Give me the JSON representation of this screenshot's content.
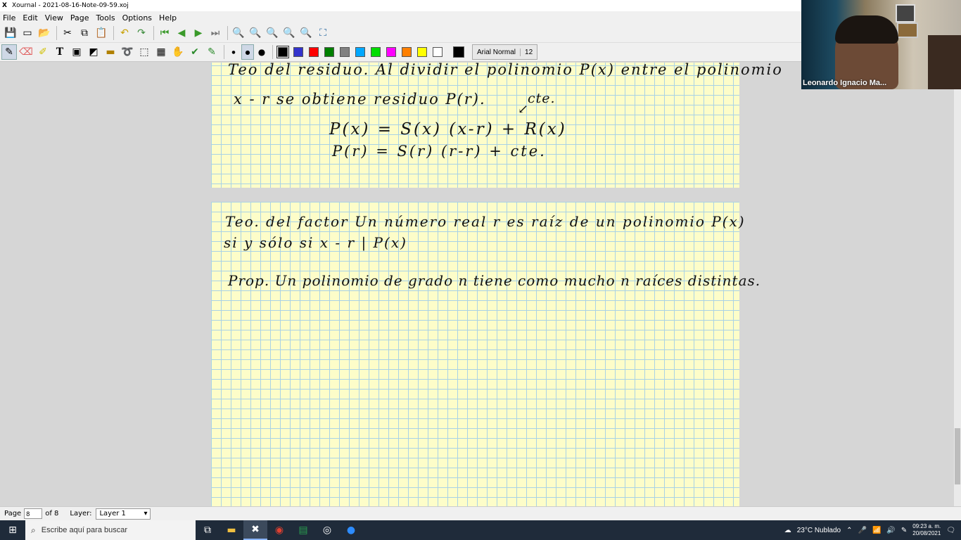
{
  "window": {
    "title": "Xournal - 2021-08-16-Note-09-59.xoj"
  },
  "menu": [
    "File",
    "Edit",
    "View",
    "Page",
    "Tools",
    "Options",
    "Help"
  ],
  "toolbar": {
    "font_name": "Arial Normal",
    "font_size": "12",
    "colors": [
      "#000000",
      "#3333cc",
      "#ff0000",
      "#008000",
      "#808080",
      "#00a8ff",
      "#00dd00",
      "#ff00ff",
      "#ff8000",
      "#ffff00",
      "#ffffff"
    ],
    "current_color": "#000000"
  },
  "notes": {
    "page1": {
      "line1": "Teo del residuo. Al dividir el polinomio  P(x)  entre el polinomio",
      "line2": "x - r   se obtiene residuo  P(r).",
      "cte_label": "cte.",
      "eq1": "P(x) = S(x) (x-r) + R(x)",
      "eq2": "P(r) =  S(r) (r-r) + cte."
    },
    "page2": {
      "line1": "Teo. del factor  Un número real  r  es raíz de un polinomio  P(x)",
      "line2": "si y sólo si   x - r | P(x)",
      "line3": "Prop. Un polinomio de grado  n  tiene como mucho  n  raíces distintas."
    }
  },
  "status": {
    "page_label": "Page",
    "page_value": "8",
    "of_pages": "of 8",
    "layer_label": "Layer:",
    "layer_value": "Layer 1"
  },
  "video": {
    "participant_name": "Leonardo Ignacio Ma..."
  },
  "taskbar": {
    "search_placeholder": "Escribe aquí para buscar",
    "weather": "23°C  Nublado",
    "time": "09:23 a. m.",
    "date": "20/08/2021"
  }
}
